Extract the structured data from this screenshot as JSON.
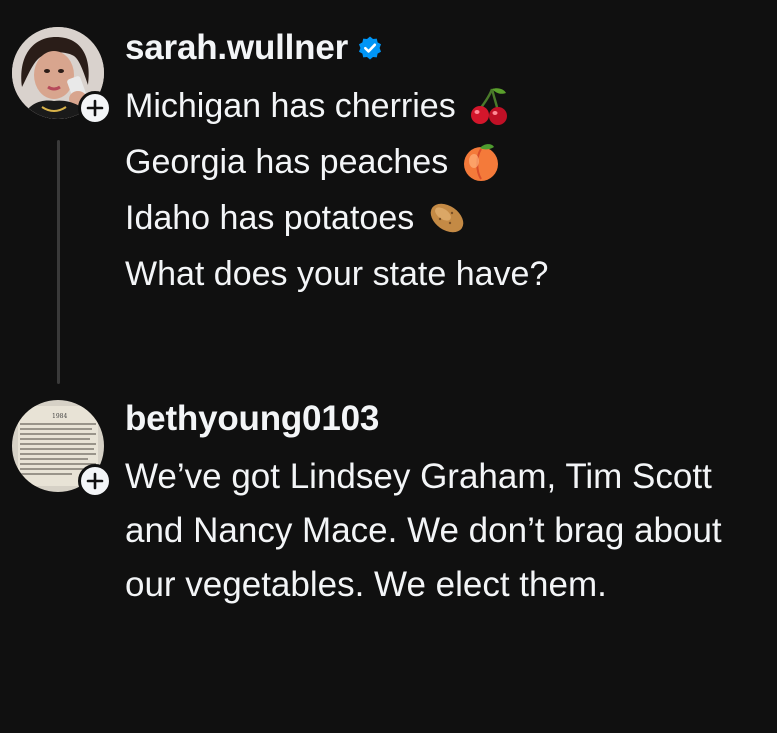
{
  "post1": {
    "username": "sarah.wullner",
    "verified": true,
    "lines": [
      {
        "text": "Michigan has cherries",
        "emoji": "cherries-emoji"
      },
      {
        "text": "Georgia has peaches",
        "emoji": "peach-emoji"
      },
      {
        "text": "Idaho has potatoes",
        "emoji": "potato-emoji"
      },
      {
        "text": "What does your state have?",
        "emoji": ""
      }
    ]
  },
  "post2": {
    "username": "bethyoung0103",
    "text": "We’ve got Lindsey Graham, Tim Scott and Nancy Mace. We don’t brag about our vegetables. We elect them.",
    "avatar_image_text": "1984"
  },
  "colors": {
    "background": "#101010",
    "text": "#f3f5f7",
    "verified": "#0095f6",
    "thread_line": "#3a3a3a"
  }
}
